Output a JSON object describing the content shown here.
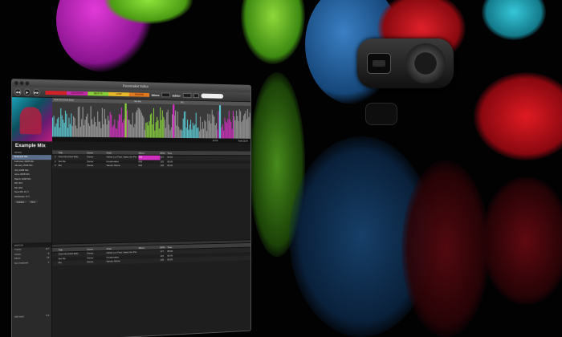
{
  "app": {
    "window_title": "Pacemaker Editor",
    "tabs": [
      {
        "label": "",
        "color": "#d0202a"
      },
      {
        "label": "COLOUR FX",
        "color": "#c22aa8"
      },
      {
        "label": "BEAT FX",
        "color": "#86d03a"
      },
      {
        "label": "LOOP",
        "color": "#e6b92b"
      },
      {
        "label": "REVERB",
        "color": "#e07a1f"
      }
    ],
    "toolbar": {
      "mixes_label": "Mixes",
      "editor_label": "Editor",
      "transport_icons": [
        "rewind-icon",
        "play-icon",
        "fast-forward-icon"
      ]
    }
  },
  "wave": {
    "track_title": "Club Kid (Club Edit)",
    "marker_2": "Set Me",
    "marker_3": "Rio",
    "time_current": "22:00",
    "total_label": "Total 22:00"
  },
  "mix": {
    "title": "Example Mix",
    "section_label": "MIXES",
    "items": [
      {
        "label": "Example Mix",
        "selected": true
      },
      {
        "label": "February 2008 Mix"
      },
      {
        "label": "January 2008 Mix"
      },
      {
        "label": "July 2008 Mix"
      },
      {
        "label": "June 2008 Mix"
      },
      {
        "label": "March 2008 Mix"
      },
      {
        "label": "Mix 001"
      },
      {
        "label": "Mix 002"
      },
      {
        "label": "New Mix 01 4"
      },
      {
        "label": "Multitrailer N°1"
      }
    ],
    "publish_label": "Publish",
    "new_label": "New"
  },
  "editor_stats": {
    "section_label": "EDITOR",
    "rows": [
      {
        "label": "Tracks",
        "value": "117"
      },
      {
        "label": "Cases",
        "value": "8"
      },
      {
        "label": "Mixes",
        "value": "18"
      },
      {
        "label": "Not Analysed",
        "value": "0"
      }
    ],
    "footer_label": "GB Used",
    "footer_value": "9.0"
  },
  "table_top": {
    "headers": [
      "",
      "Title",
      "Genre",
      "Artist",
      "Album",
      "BPM",
      "Time"
    ],
    "rows": [
      [
        "1",
        "Club Kid (Club Edit)",
        "Dance",
        "Adrian Lux Feat. Naeto the Pet",
        "000",
        "127",
        "05:00"
      ],
      [
        "2",
        "Set Me",
        "Dance",
        "Housemates",
        "000",
        "125",
        "06:45"
      ],
      [
        "3",
        "Rio",
        "Dance",
        "Sandro Monte",
        "000",
        "128",
        "06:00"
      ]
    ]
  },
  "table_bottom": {
    "headers": [
      "",
      "Title",
      "Genre",
      "Artist",
      "Album",
      "BPM",
      "Time"
    ],
    "rows": [
      [
        "",
        "Club Kid (Club Edit)",
        "Dance",
        "Adrian Lux Feat. Naeto the Pet",
        "",
        "127",
        "05:00"
      ],
      [
        "",
        "Set Me",
        "Dance",
        "Housemates",
        "",
        "125",
        "06:45"
      ],
      [
        "",
        "Rio",
        "Dance",
        "Sandro Monte",
        "",
        "128",
        "06:00"
      ]
    ]
  }
}
